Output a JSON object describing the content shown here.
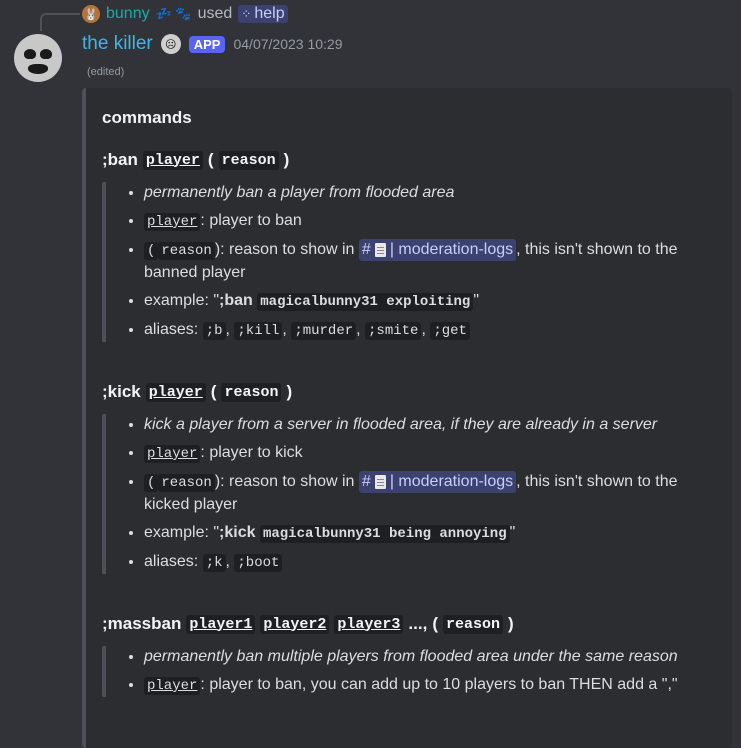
{
  "reply": {
    "user": "bunny",
    "emoji": "💤 🐾",
    "used_text": "used",
    "command": "help"
  },
  "message": {
    "username": "the killer",
    "badge": "APP",
    "timestamp": "04/07/2023 10:29",
    "edited": "(edited)"
  },
  "embed": {
    "title": "commands",
    "sections": [
      {
        "title_prefix": ";ban",
        "args": [
          "player"
        ],
        "extra_punct": "",
        "optional": "reason",
        "desc": "permanently ban a player from flooded area",
        "arg1_code": "player",
        "arg1_text": ": player to ban",
        "reason_code": "reason",
        "reason_pre": "(",
        "reason_post": "): reason to show in",
        "channel": "| moderation-logs",
        "reason_tail": ", this isn't shown to the banned player",
        "example_label": "example: \"",
        "example_cmd": ";ban",
        "example_code": "magicalbunny31 exploiting",
        "example_end": "\"",
        "aliases_label": "aliases:",
        "aliases": [
          ";b",
          ";kill",
          ";murder",
          ";smite",
          ";get"
        ]
      },
      {
        "title_prefix": ";kick",
        "args": [
          "player"
        ],
        "optional": "reason",
        "desc": "kick a player from a server in flooded area, if they are already in a server",
        "arg1_code": "player",
        "arg1_text": ": player to kick",
        "reason_code": "reason",
        "reason_pre": "(",
        "reason_post": "): reason to show in",
        "channel": "| moderation-logs",
        "reason_tail": ", this isn't shown to the kicked player",
        "example_label": "example: \"",
        "example_cmd": ";kick",
        "example_code": "magicalbunny31 being annoying",
        "example_end": "\"",
        "aliases_label": "aliases:",
        "aliases": [
          ";k",
          ";boot"
        ]
      },
      {
        "title_prefix": ";massban",
        "args": [
          "player1",
          "player2",
          "player3"
        ],
        "extra_punct": "...,",
        "optional": "reason",
        "desc": "permanently ban multiple players from flooded area under the same reason",
        "arg1_code": "player",
        "arg1_text": ": player to ban, you can add up to 10 players to ban THEN add a \",\""
      }
    ]
  },
  "colors": {
    "accent": "#5865f2",
    "background": "#313338",
    "embed": "#2b2d31"
  },
  "icons": [
    "hash-icon",
    "document-icon",
    "command-grid-icon"
  ]
}
